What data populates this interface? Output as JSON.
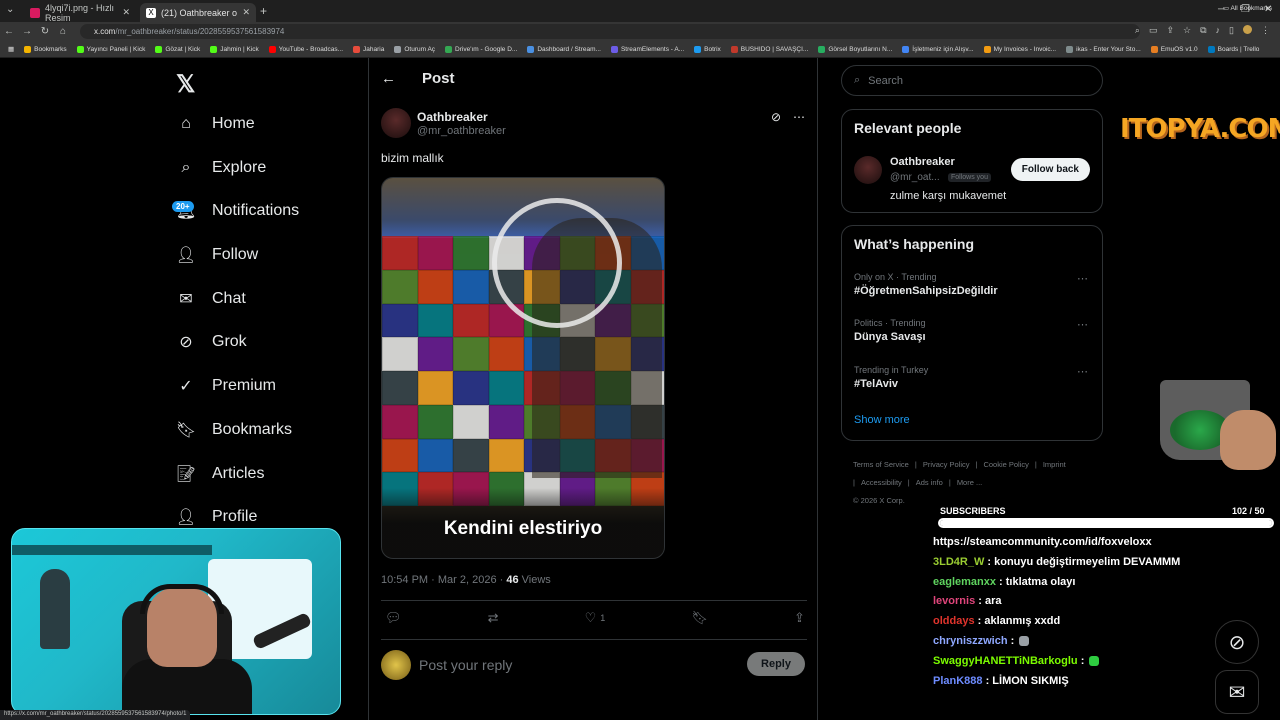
{
  "browser": {
    "tabs": [
      {
        "title": "4lyqi7i.png - Hızlı Resim",
        "color": "#d81b60"
      },
      {
        "title": "(21) Oathbreaker on X: \"bizim m",
        "color": "#ffffff"
      }
    ],
    "new_tab": "+",
    "url_domain": "x.com",
    "url_path": "/mr_oathbreaker/status/2028559537561583974",
    "bookmarks": [
      {
        "label": "Bookmarks",
        "color": "#f4b400"
      },
      {
        "label": "Yayıncı Paneli | Kick",
        "color": "#53fc18"
      },
      {
        "label": "Gözat | Kick",
        "color": "#53fc18"
      },
      {
        "label": "Jahmin | Kick",
        "color": "#53fc18"
      },
      {
        "label": "YouTube - Broadcas...",
        "color": "#ff0000"
      },
      {
        "label": "Jaharia",
        "color": "#e74c3c"
      },
      {
        "label": "Oturum Aç",
        "color": "#9aa0a6"
      },
      {
        "label": "Drive'ım - Google D...",
        "color": "#34a853"
      },
      {
        "label": "Dashboard / Stream...",
        "color": "#4a90e2"
      },
      {
        "label": "StreamElements - A...",
        "color": "#6c5ce7"
      },
      {
        "label": "Botrix",
        "color": "#1d9bf0"
      },
      {
        "label": "BUSHIDO | SAVAŞÇI...",
        "color": "#c0392b"
      },
      {
        "label": "Görsel Boyutlarını N...",
        "color": "#27ae60"
      },
      {
        "label": "İşletmeniz için Alışv...",
        "color": "#4285f4"
      },
      {
        "label": "My Invoices - Invoic...",
        "color": "#f39c12"
      },
      {
        "label": "ikas - Enter Your Sto...",
        "color": "#7f8c8d"
      },
      {
        "label": "EmuOS v1.0",
        "color": "#e67e22"
      },
      {
        "label": "Boards | Trello",
        "color": "#0079bf"
      }
    ],
    "all_bookmarks": "All Bookmarks",
    "status_url": "https://x.com/mr_oathbreaker/status/2028559537561583974/photo/1"
  },
  "nav": {
    "logo": "𝕏",
    "items": [
      {
        "label": "Home",
        "icon": "⌂"
      },
      {
        "label": "Explore",
        "icon": "⌕"
      },
      {
        "label": "Notifications",
        "icon": "🔔︎"
      },
      {
        "label": "Follow",
        "icon": "👤︎"
      },
      {
        "label": "Chat",
        "icon": "✉"
      },
      {
        "label": "Grok",
        "icon": "⊘"
      },
      {
        "label": "Premium",
        "icon": "✓"
      },
      {
        "label": "Bookmarks",
        "icon": "🔖︎"
      },
      {
        "label": "Articles",
        "icon": "📝︎"
      },
      {
        "label": "Profile",
        "icon": "👤︎"
      }
    ],
    "notifications_badge": "20+"
  },
  "post": {
    "header_title": "Post",
    "back": "←",
    "author_name": "Oathbreaker",
    "author_handle": "@mr_oathbreaker",
    "text": "bizim mallık",
    "media_caption": "Kendini elestiriyo",
    "timestamp": "10:54 PM · Mar 2, 2026 · ",
    "views_count": "46",
    "views_label": " Views",
    "like_count": "1",
    "reply_placeholder": "Post your reply",
    "reply_button": "Reply"
  },
  "sidebar": {
    "search_placeholder": "Search",
    "relevant_title": "Relevant people",
    "person": {
      "name": "Oathbreaker",
      "handle": "@mr_oat...",
      "follows_you": "Follows you",
      "bio": "zulme karşı mukavemet",
      "button": "Follow back"
    },
    "happening_title": "What’s happening",
    "trends": [
      {
        "meta": "Only on X · Trending",
        "name": "#ÖğretmenSahipsizDeğildir"
      },
      {
        "meta": "Politics · Trending",
        "name": "Dünya Savaşı"
      },
      {
        "meta": "Trending in Turkey",
        "name": "#TelAviv"
      }
    ],
    "show_more": "Show more",
    "footer": [
      "Terms of Service",
      "|",
      "Privacy Policy",
      "|",
      "Cookie Policy",
      "|",
      "Imprint",
      "|",
      "Accessibility",
      "|",
      "Ads info",
      "|",
      "More ...",
      "© 2026 X Corp."
    ]
  },
  "overlay": {
    "sponsor": "ITOPYA.COM",
    "subscribers_label": "SUBSCRIBERS",
    "subscribers_count": "102  / 50",
    "subscribers_fill": 1.0,
    "chat": [
      {
        "user": "",
        "text": "https://steamcommunity.com/id/foxveloxx",
        "color": "#ffffff"
      },
      {
        "user": "3LD4R_W",
        "text": " : konuyu değiştirmeyelim DEVAMMM",
        "color": "#9acd32"
      },
      {
        "user": "eaglemanxx",
        "text": " : tıklatma olayı",
        "color": "#5fd35f"
      },
      {
        "user": "levornis",
        "text": " : ara",
        "color": "#e0457b"
      },
      {
        "user": "olddays",
        "text": " : aklanmış xxdd",
        "color": "#e0342c"
      },
      {
        "user": "chryniszzwich",
        "text": " : ",
        "color": "#8fa8ff"
      },
      {
        "user": "SwaggyHANETTiNBarkoglu",
        "text": " : ",
        "color": "#7cfc00"
      },
      {
        "user": "PlanK888",
        "text": " : LİMON SIKMIŞ",
        "color": "#6e8cff"
      }
    ]
  }
}
